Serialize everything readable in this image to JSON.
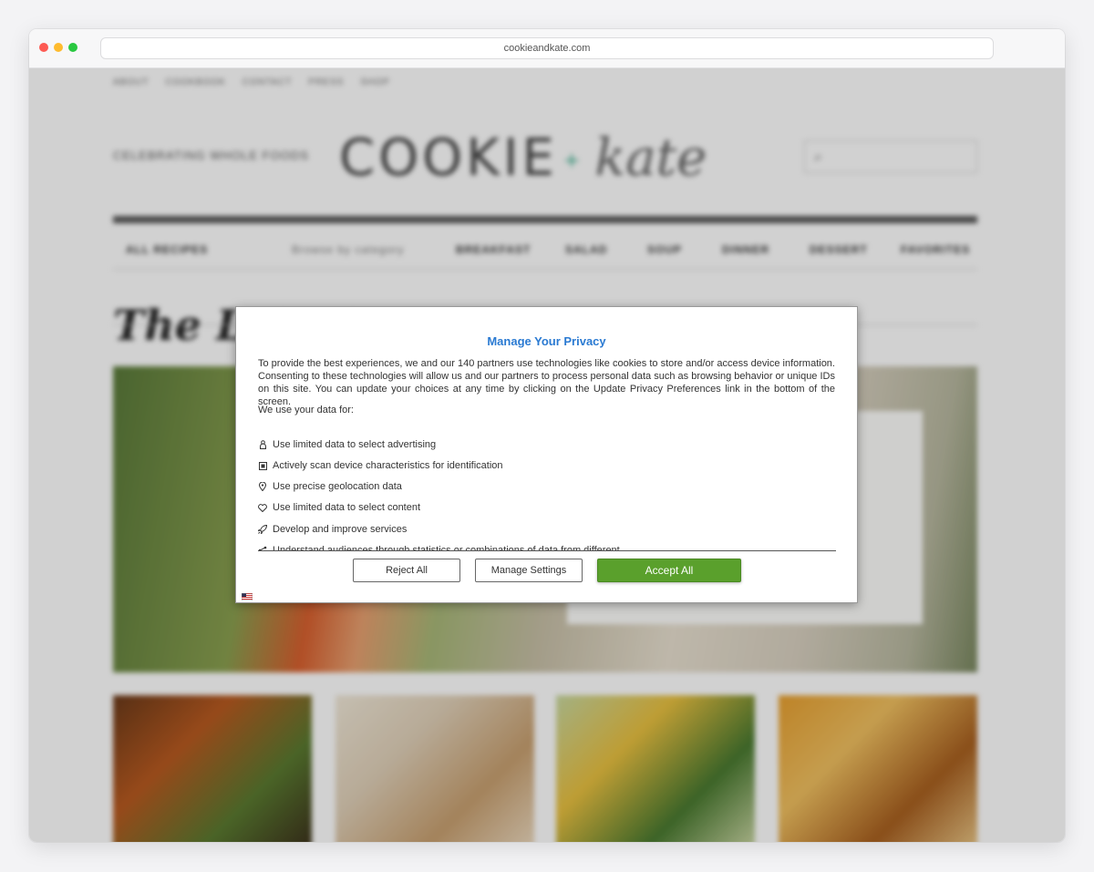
{
  "browser": {
    "url": "cookieandkate.com"
  },
  "site": {
    "topnav": [
      "ABOUT",
      "COOKBOOK",
      "CONTACT",
      "PRESS",
      "SHOP"
    ],
    "tagline": "CELEBRATING WHOLE FOODS",
    "logo_main": "COOKIE",
    "logo_sep": "+",
    "logo_script": "kate",
    "categories": [
      "ALL RECIPES",
      "Browse by category",
      "BREAKFAST",
      "SALAD",
      "SOUP",
      "DINNER",
      "DESSERT",
      "FAVORITES"
    ],
    "latest_heading": "The Latest"
  },
  "modal": {
    "title": "Manage Your Privacy",
    "intro": "To provide the best experiences, we and our 140 partners use technologies like cookies to store and/or access device information. Consenting to these technologies will allow us and our partners to process personal data such as browsing behavior or unique IDs on this site. You can update your choices at any time by clicking on the Update Privacy Preferences link in the bottom of the screen.",
    "uses_label": "We use your data for:",
    "purposes": [
      {
        "icon": "person-icon",
        "text": "Use limited data to select advertising"
      },
      {
        "icon": "device-scan-icon",
        "text": "Actively scan device characteristics for identification"
      },
      {
        "icon": "location-pin-icon",
        "text": "Use precise geolocation data"
      },
      {
        "icon": "heart-icon",
        "text": "Use limited data to select content"
      },
      {
        "icon": "rocket-icon",
        "text": "Develop and improve services"
      },
      {
        "icon": "share-icon",
        "text": "Understand audiences through statistics or combinations of data from different"
      }
    ],
    "reject_label": "Reject All",
    "manage_label": "Manage Settings",
    "accept_label": "Accept All",
    "language_flag": "english-flag-icon"
  },
  "colors": {
    "title_blue": "#2a7ad2",
    "accept_green": "#5aa02c"
  }
}
